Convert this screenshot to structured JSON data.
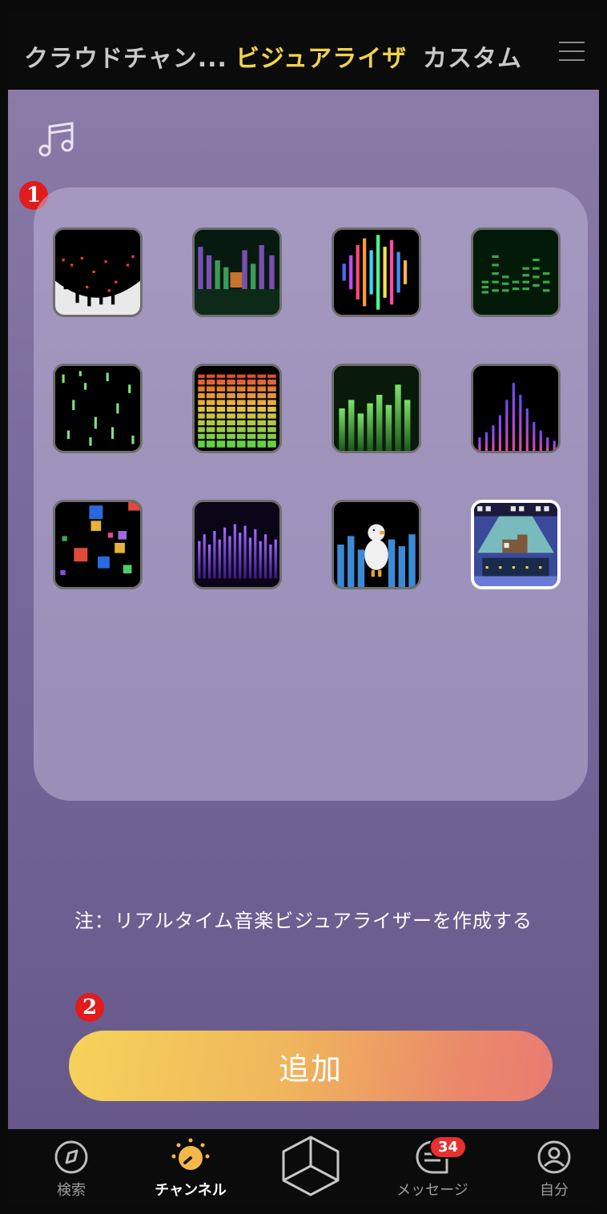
{
  "header": {
    "tabs": [
      {
        "label": "クラウドチャン..."
      },
      {
        "label": "ビジュアライザ"
      },
      {
        "label": "カスタム"
      }
    ],
    "active_tab": "ビジュアライザ"
  },
  "markers": {
    "one": "1",
    "two": "2"
  },
  "visualizers": [
    {
      "name": "falling-dots"
    },
    {
      "name": "pixel-character-bars"
    },
    {
      "name": "rainbow-waveform"
    },
    {
      "name": "green-equalizer"
    },
    {
      "name": "green-rain"
    },
    {
      "name": "gradient-led-bars"
    },
    {
      "name": "green-bars"
    },
    {
      "name": "pink-purple-spectrum"
    },
    {
      "name": "colored-squares"
    },
    {
      "name": "purple-bars"
    },
    {
      "name": "bird-bars"
    },
    {
      "name": "pixel-cat-scene"
    }
  ],
  "selected_index": 11,
  "note": "注：リアルタイム音楽ビジュアライザーを作成する",
  "add_button": "追加",
  "nav": {
    "items": [
      {
        "label": "検索",
        "icon": "compass-icon"
      },
      {
        "label": "チャンネル",
        "icon": "dial-icon"
      },
      {
        "label": "",
        "icon": "cube-icon"
      },
      {
        "label": "メッセージ",
        "icon": "message-icon",
        "badge": "34"
      },
      {
        "label": "自分",
        "icon": "user-icon"
      }
    ],
    "active": "チャンネル"
  },
  "colors": {
    "accent": "#f2d24a",
    "badge": "#e8302f",
    "marker": "#e21b1b"
  }
}
